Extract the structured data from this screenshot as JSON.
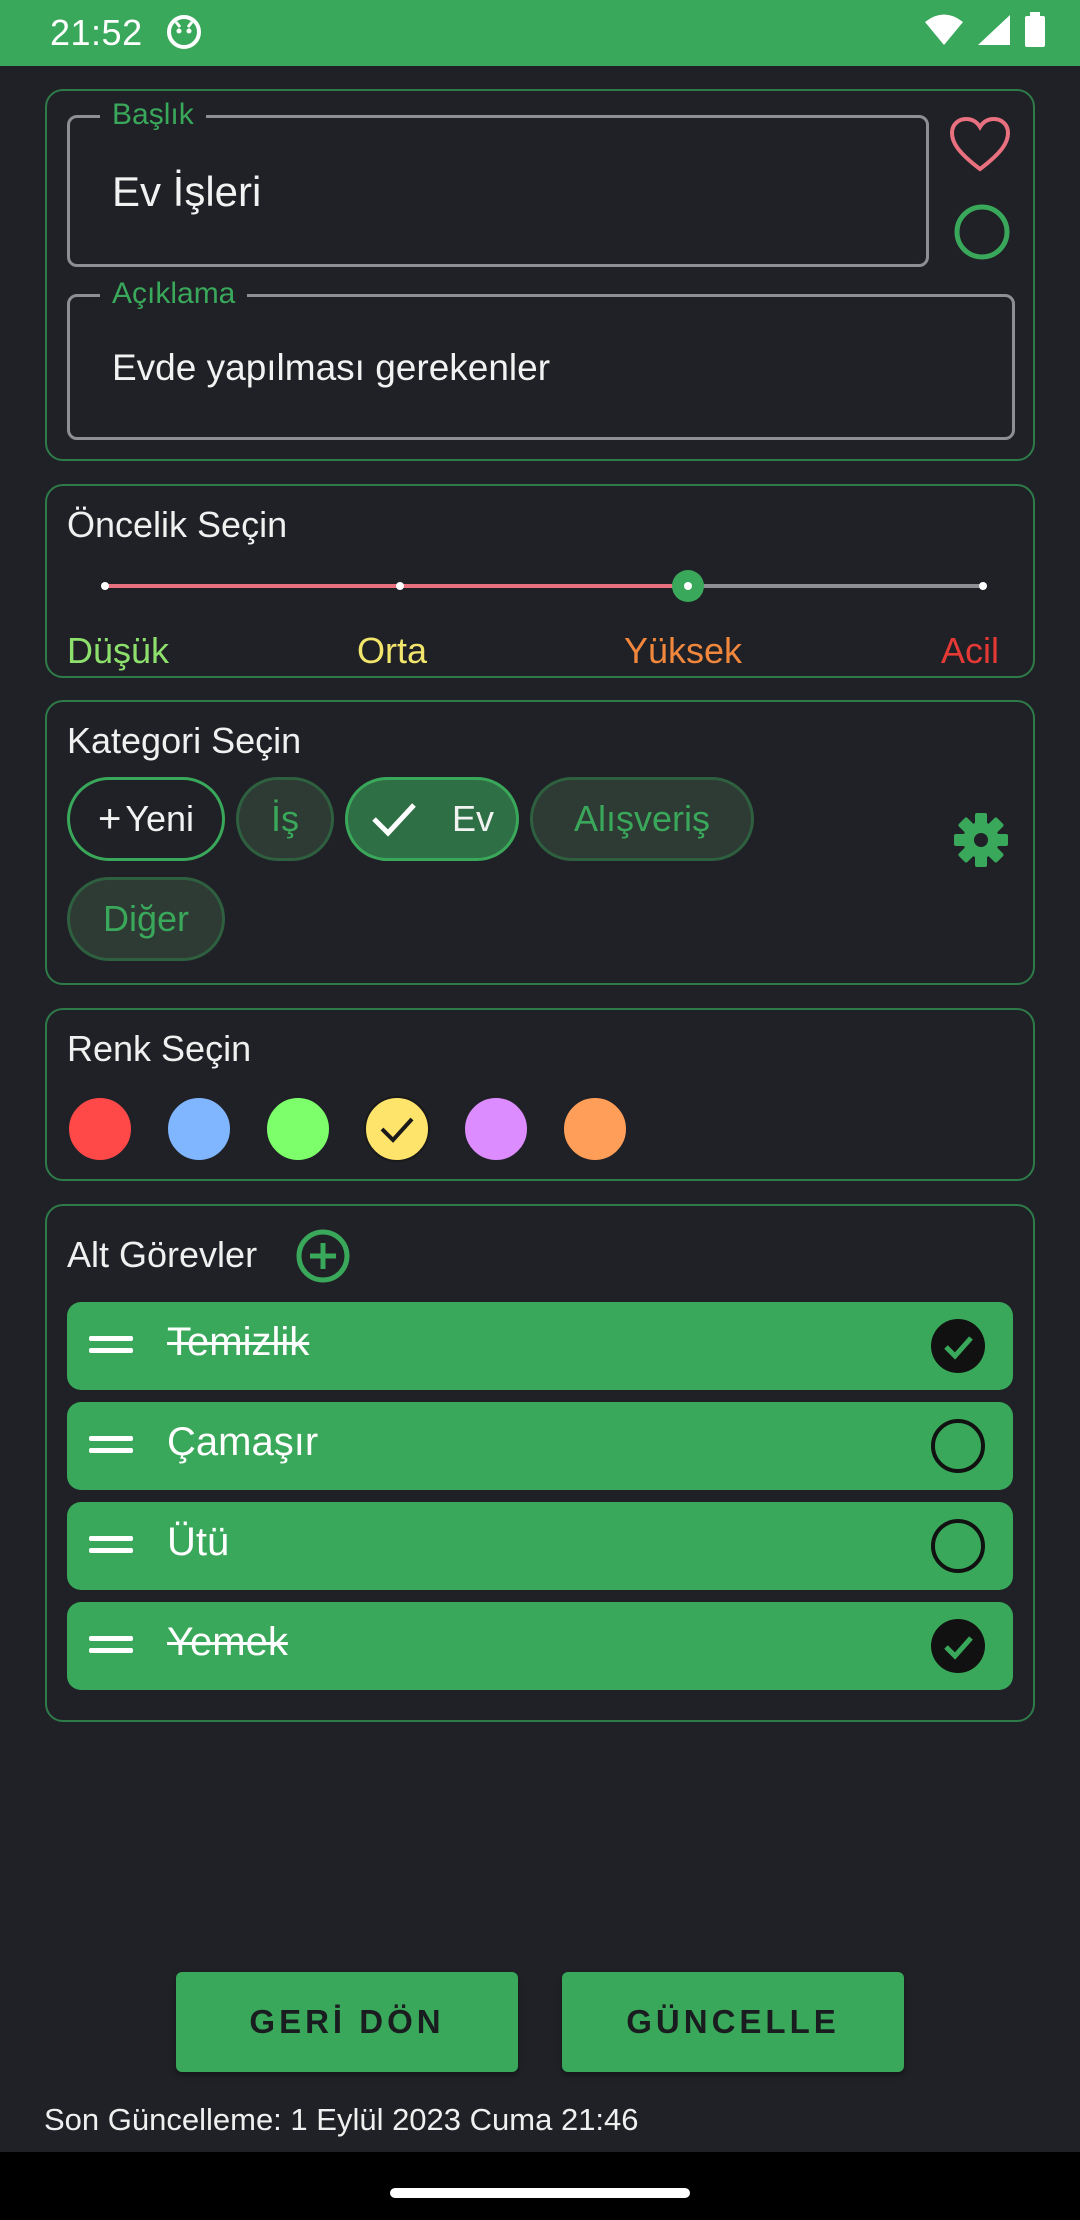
{
  "status_bar": {
    "time": "21:52"
  },
  "title_card": {
    "title_field": {
      "label": "Başlık",
      "value": "Ev İşleri"
    },
    "description_field": {
      "label": "Açıklama",
      "value": "Evde yapılması gerekenler"
    },
    "favorite_icon": "heart-outline-icon",
    "complete_icon": "circle-outline-icon"
  },
  "priority": {
    "title": "Öncelik Seçin",
    "levels": [
      {
        "label": "Düşük",
        "color": "#8ee06d"
      },
      {
        "label": "Orta",
        "color": "#f1e56b"
      },
      {
        "label": "Yüksek",
        "color": "#f0873d"
      },
      {
        "label": "Acil",
        "color": "#e53935"
      }
    ],
    "selected_index": 2
  },
  "category": {
    "title": "Kategori Seçin",
    "new_chip": "Yeni",
    "chips": [
      "İş",
      "Ev",
      "Alışveriş",
      "Diğer"
    ],
    "selected": "Ev",
    "settings_icon": "gear-icon"
  },
  "color": {
    "title": "Renk Seçin",
    "swatches": [
      "#ff4848",
      "#7fb6ff",
      "#7dff6b",
      "#ffe46b",
      "#dc8cff",
      "#ff9e58"
    ],
    "selected_index": 3
  },
  "subtasks": {
    "title": "Alt Görevler",
    "add_icon": "add-circle-icon",
    "items": [
      {
        "label": "Temizlik",
        "done": true
      },
      {
        "label": "Çamaşır",
        "done": false
      },
      {
        "label": "Ütü",
        "done": false
      },
      {
        "label": "Yemek",
        "done": true
      }
    ]
  },
  "buttons": {
    "back": "GERİ DÖN",
    "update": "GÜNCELLE"
  },
  "footer": {
    "last_updated": "Son Güncelleme: 1 Eylül 2023 Cuma 21:46"
  },
  "accent_color": "#3aa85a"
}
